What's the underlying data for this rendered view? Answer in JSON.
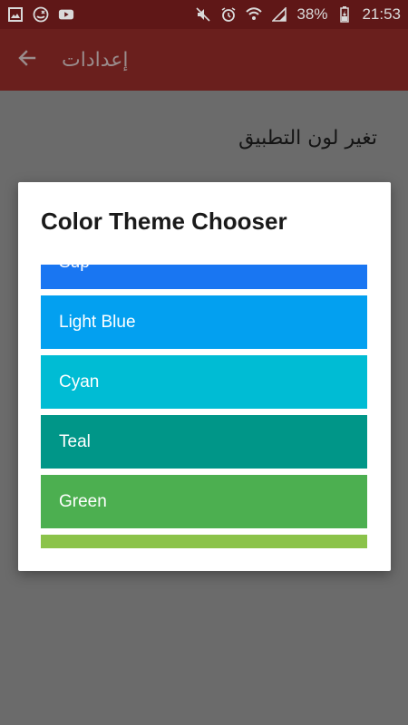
{
  "status_bar": {
    "battery": "38%",
    "time": "21:53",
    "icons_left": [
      "image-icon",
      "missed-call-icon",
      "youtube-icon"
    ],
    "icons_right": [
      "mute-icon",
      "alarm-icon",
      "wifi-icon",
      "signal-icon",
      "battery-charging-icon"
    ]
  },
  "app_bar": {
    "title": "إعدادات",
    "back_icon": "arrow-back-icon",
    "background": "#6a1f1d"
  },
  "settings": {
    "app_color_label": "تغير لون التطبيق"
  },
  "dialog": {
    "title": "Color Theme Chooser",
    "items": [
      {
        "label": "Sup",
        "color": "#1976f2"
      },
      {
        "label": "Light Blue",
        "color": "#03a0f0"
      },
      {
        "label": "Cyan",
        "color": "#00bcd4"
      },
      {
        "label": "Teal",
        "color": "#009688"
      },
      {
        "label": "Green",
        "color": "#4caf50"
      },
      {
        "label": "",
        "color": "#8bc34a"
      }
    ]
  }
}
